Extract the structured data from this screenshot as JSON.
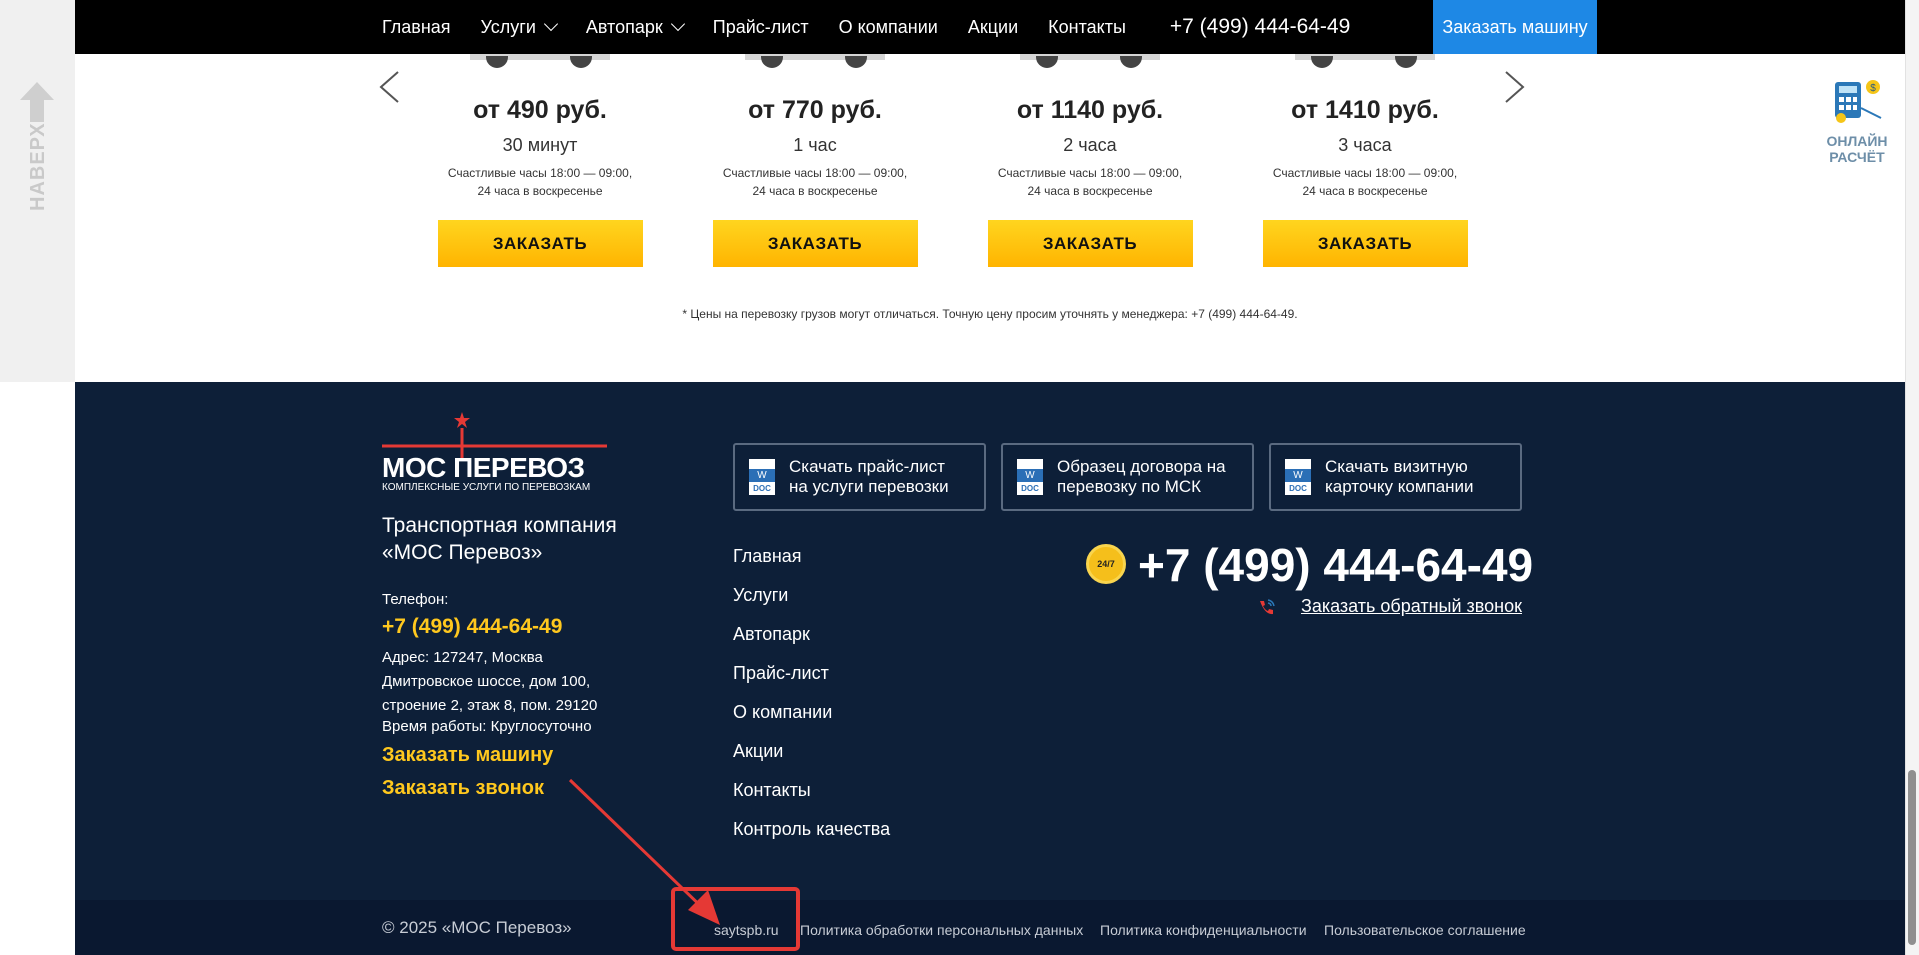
{
  "sidebar": {
    "up_label": "НАВЕРХ"
  },
  "nav": {
    "items": [
      {
        "label": "Главная",
        "dropdown": false
      },
      {
        "label": "Услуги",
        "dropdown": true
      },
      {
        "label": "Автопарк",
        "dropdown": true
      },
      {
        "label": "Прайс-лист",
        "dropdown": false
      },
      {
        "label": "О компании",
        "dropdown": false
      },
      {
        "label": "Акции",
        "dropdown": false
      },
      {
        "label": "Контакты",
        "dropdown": false
      }
    ],
    "phone": "+7 (499) 444-64-49",
    "order_button": "Заказать машину"
  },
  "pricing": {
    "cards": [
      {
        "price": "от 490 руб.",
        "duration": "30 минут",
        "note_line1": "Счастливые часы 18:00 — 09:00,",
        "note_line2": "24 часа в воскресенье",
        "button": "ЗАКАЗАТЬ"
      },
      {
        "price": "от 770 руб.",
        "duration": "1 час",
        "note_line1": "Счастливые часы 18:00 — 09:00,",
        "note_line2": "24 часа в воскресенье",
        "button": "ЗАКАЗАТЬ"
      },
      {
        "price": "от 1140 руб.",
        "duration": "2 часа",
        "note_line1": "Счастливые часы 18:00 — 09:00,",
        "note_line2": "24 часа в воскресенье",
        "button": "ЗАКАЗАТЬ"
      },
      {
        "price": "от 1410 руб.",
        "duration": "3 часа",
        "note_line1": "Счастливые часы 18:00 — 09:00,",
        "note_line2": "24 часа в воскресенье",
        "button": "ЗАКАЗАТЬ"
      }
    ],
    "disclaimer": "* Цены на перевозку грузов могут отличаться. Точную цену просим уточнять у менеджера: +7 (499) 444-64-49."
  },
  "calc_widget": {
    "line1": "ОНЛАЙН",
    "line2": "РАСЧЁТ"
  },
  "footer": {
    "logo": {
      "title": "МОС ПЕРЕВОЗ",
      "subtitle": "КОМПЛЕКСНЫЕ УСЛУГИ ПО ПЕРЕВОЗКАМ"
    },
    "company_line1": "Транспортная компания",
    "company_line2": "«МОС Перевоз»",
    "phone_label": "Телефон:",
    "phone": "+7 (499) 444-64-49",
    "address_line1": "Адрес: 127247, Москва",
    "address_line2": "Дмитровское шоссе, дом 100,",
    "address_line3": "строение 2, этаж 8, пом. 29120",
    "hours": "Время работы: Круглосуточно",
    "order_car": "Заказать машину",
    "order_call": "Заказать звонок",
    "docs": [
      {
        "icon_letter": "W",
        "icon_ext": "DOC",
        "line1": "Скачать прайс-лист",
        "line2": "на услуги перевозки"
      },
      {
        "icon_letter": "W",
        "icon_ext": "DOC",
        "line1": "Образец договора на",
        "line2": "перевозку по МСК"
      },
      {
        "icon_letter": "W",
        "icon_ext": "DOC",
        "line1": "Скачать визитную",
        "line2": "карточку компании"
      }
    ],
    "menu": [
      "Главная",
      "Услуги",
      "Автопарк",
      "Прайс-лист",
      "О компании",
      "Акции",
      "Контакты",
      "Контроль качества"
    ],
    "badge": "24/7",
    "big_phone": "+7 (499) 444-64-49",
    "callback": "Заказать обратный звонок",
    "bottom": {
      "copyright": "© 2025 «МОС Перевоз»",
      "developer": "saytspb.ru",
      "privacy_data": "Политика обработки персональных данных",
      "privacy": "Политика конфиденциальности",
      "agreement": "Пользовательское соглашение"
    }
  },
  "colors": {
    "accent_yellow": "#ffc81e",
    "nav_blue": "#1e88e5",
    "footer_bg": "#0d1f38",
    "annotation_red": "#e53935"
  }
}
